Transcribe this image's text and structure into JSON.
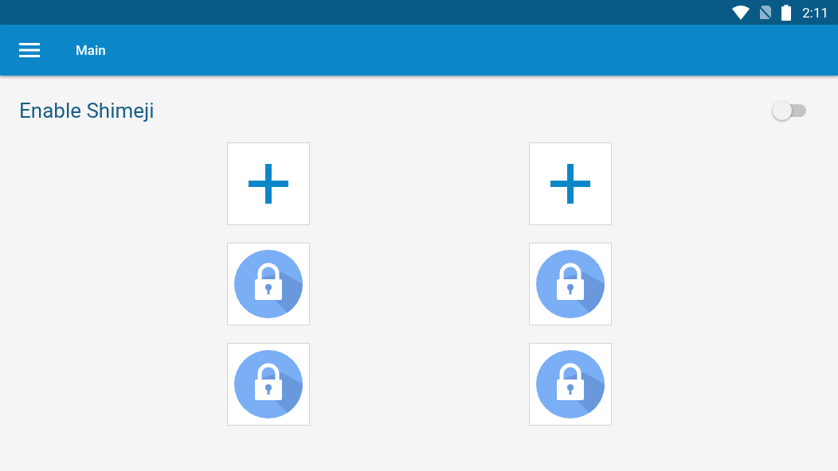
{
  "status_bar": {
    "time": "2:11"
  },
  "app_bar": {
    "title": "Main"
  },
  "setting": {
    "label": "Enable Shimeji",
    "on": false
  },
  "slots": [
    {
      "kind": "add"
    },
    {
      "kind": "add"
    },
    {
      "kind": "locked"
    },
    {
      "kind": "locked"
    },
    {
      "kind": "locked"
    },
    {
      "kind": "locked"
    }
  ]
}
